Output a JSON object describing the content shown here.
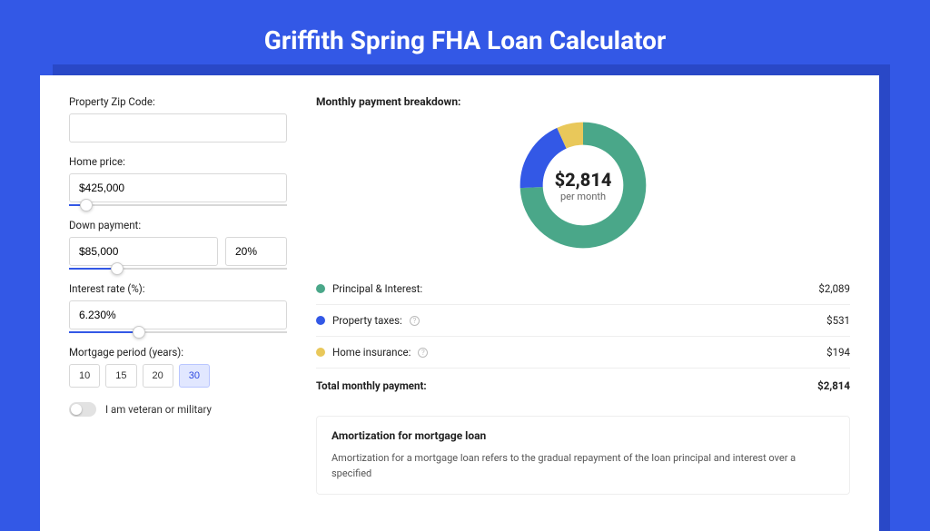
{
  "title": "Griffith Spring FHA Loan Calculator",
  "form": {
    "zip_label": "Property Zip Code:",
    "zip_value": "",
    "home_price_label": "Home price:",
    "home_price_value": "$425,000",
    "down_payment_label": "Down payment:",
    "down_payment_value": "$85,000",
    "down_payment_pct": "20%",
    "interest_rate_label": "Interest rate (%):",
    "interest_rate_value": "6.230%",
    "mortgage_period_label": "Mortgage period (years):",
    "mortgage_period_options": [
      "10",
      "15",
      "20",
      "30"
    ],
    "mortgage_period_selected": "30",
    "veteran_label": "I am veteran or military",
    "slider_positions": {
      "home_price": 8,
      "down_payment": 22,
      "interest_rate": 32
    }
  },
  "breakdown": {
    "title": "Monthly payment breakdown:",
    "donut_total": "$2,814",
    "donut_sub": "per month",
    "rows": [
      {
        "color": "green",
        "label": "Principal & Interest:",
        "info": false,
        "value": "$2,089"
      },
      {
        "color": "blue",
        "label": "Property taxes:",
        "info": true,
        "value": "$531"
      },
      {
        "color": "yellow",
        "label": "Home insurance:",
        "info": true,
        "value": "$194"
      }
    ],
    "total_label": "Total monthly payment:",
    "total_value": "$2,814"
  },
  "amortization": {
    "title": "Amortization for mortgage loan",
    "body": "Amortization for a mortgage loan refers to the gradual repayment of the loan principal and interest over a specified"
  },
  "chart_data": {
    "type": "pie",
    "title": "Monthly payment breakdown",
    "series": [
      {
        "name": "Principal & Interest",
        "value": 2089,
        "color": "#4aa789"
      },
      {
        "name": "Property taxes",
        "value": 531,
        "color": "#3358e6"
      },
      {
        "name": "Home insurance",
        "value": 194,
        "color": "#e9c85a"
      }
    ],
    "total": 2814,
    "center_label": "$2,814 per month"
  }
}
